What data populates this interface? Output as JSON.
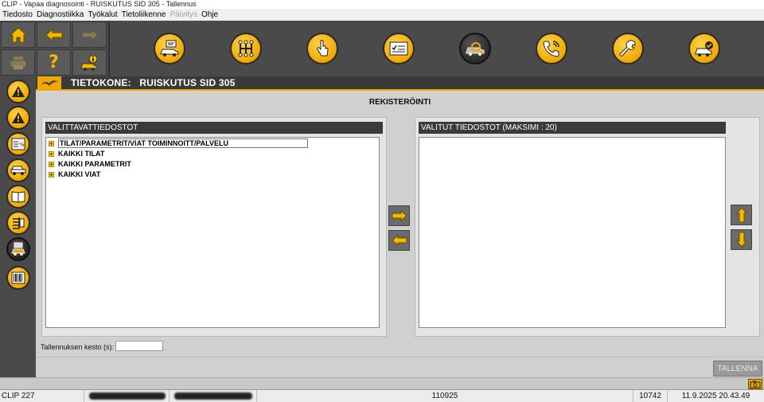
{
  "window": {
    "title": "CLIP - Vapaa diagnosointi - RUISKUTUS SID 305 - Tallennus"
  },
  "menu": [
    {
      "label": "Tiedosto",
      "enabled": true
    },
    {
      "label": "Diagnostiikka",
      "enabled": true
    },
    {
      "label": "Työkalut",
      "enabled": true
    },
    {
      "label": "Tietoliikenne",
      "enabled": true
    },
    {
      "label": "Päivitys",
      "enabled": false
    },
    {
      "label": "Ohje",
      "enabled": true
    }
  ],
  "toolbar": {
    "left_icons": [
      "home-icon",
      "back-arrow-icon",
      "forward-arrow-icon",
      "printer-icon",
      "help-icon",
      "vehicle-info-icon"
    ],
    "main_icons": [
      "vehicle-identification-icon",
      "gearbox-icon",
      "touch-icon",
      "checklist-icon",
      "vehicle-scan-icon",
      "phone-support-icon",
      "wrench-icon",
      "vehicle-check-icon"
    ],
    "active_index": 4
  },
  "sidebar": {
    "icons": [
      "warning-icon",
      "warning-icon",
      "parameters-icon",
      "vehicles-icon",
      "manual-icon",
      "wiring-icon",
      "vehicle-record-icon",
      "barcode-icon"
    ],
    "active_index": 6
  },
  "header": {
    "title": "TIETOKONE:   RUISKUTUS SID 305"
  },
  "page": {
    "title": "REKISTERÖINTI"
  },
  "available_panel": {
    "title": "VALITTAVATTIEDOSTOT",
    "items": [
      {
        "label": "TILAT/PARAMETRIT/VIAT TOIMINNOITT/PALVELU"
      },
      {
        "label": "KAIKKI TILAT"
      },
      {
        "label": "KAIKKI PARAMETRIT"
      },
      {
        "label": "KAIKKI VIAT"
      }
    ],
    "selected_index": 0
  },
  "selected_panel": {
    "title": "VALITUT TIEDOSTOT (MAKSIMI : 20)",
    "items": []
  },
  "duration": {
    "label": "Tallennuksen kesto (s):",
    "value": ""
  },
  "save_button": {
    "label": "TALLENNA",
    "enabled": false
  },
  "statusbar": {
    "version": "CLIP 227",
    "code": "110925",
    "number": "10742",
    "datetime": "11.9.2025 20.43.49"
  },
  "colors": {
    "accent": "#f0a800",
    "dark": "#3a3a3a"
  }
}
